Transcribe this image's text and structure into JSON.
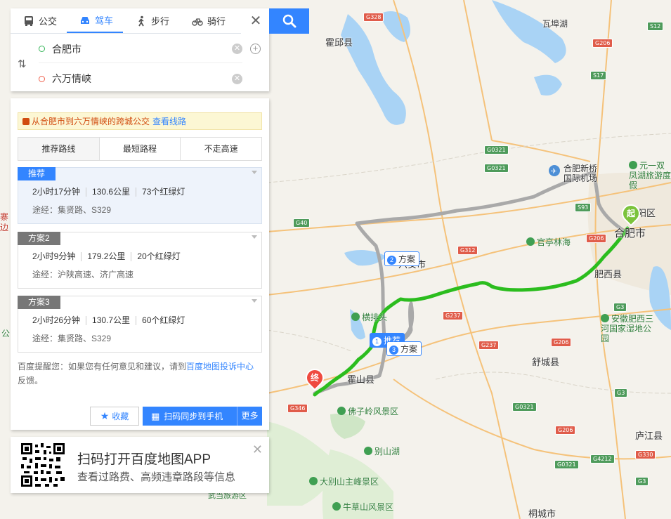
{
  "modes": {
    "bus": "公交",
    "drive": "驾车",
    "walk": "步行",
    "bike": "骑行"
  },
  "route": {
    "from": "合肥市",
    "to": "六万情峡"
  },
  "bus_tip": {
    "text": "从合肥市到六万情峡的跨城公交",
    "link": "查看线路"
  },
  "strategies": [
    "推荐路线",
    "最短路程",
    "不走高速"
  ],
  "plans": [
    {
      "tag": "推荐",
      "time": "2小时17分钟",
      "distance": "130.6公里",
      "lights": "73个红绿灯",
      "via": "途经：集贤路、S329"
    },
    {
      "tag": "方案2",
      "time": "2小时9分钟",
      "distance": "179.2公里",
      "lights": "20个红绿灯",
      "via": "途经：沪陕高速、济广高速"
    },
    {
      "tag": "方案3",
      "time": "2小时26分钟",
      "distance": "130.7公里",
      "lights": "60个红绿灯",
      "via": "途经：集贤路、S329"
    }
  ],
  "notice": {
    "before": "百度提醒您：如果您有任何意见和建议，请到",
    "link": "百度地图投诉中心",
    "after": "反馈。"
  },
  "actions": {
    "favorite": "收藏",
    "sync": "扫码同步到手机",
    "more": "更多"
  },
  "qr_card": {
    "title": "扫码打开百度地图APP",
    "subtitle": "查看过路费、高频违章路段等信息"
  },
  "map": {
    "labels": {
      "huoqiu": "霍邱县",
      "wawuhu": "瓦埠湖",
      "hefei": "合肥市",
      "yangqu": "阳区",
      "feixi": "肥西县",
      "shucheng": "舒城县",
      "huoshan": "霍山县",
      "luan": "六安市",
      "lujiang": "庐江县",
      "tongcheng": "桐城市",
      "hefei_airport": "合肥新桥国际机场",
      "yiyi_lake": "元一双凤湖旅游度假",
      "guanting": "官亭林海",
      "hengpai": "横排头",
      "three_rivers": "安徽肥西三河国家湿地公园",
      "fozi": "佛子岭风景区",
      "bieshan": "别山湖",
      "dabie": "大别山主峰景区",
      "niucao": "牛草山风景区",
      "wudang": "武当旅游区",
      "left_edge_1": "寨",
      "left_edge_2": "边",
      "left_edge_3": "公"
    },
    "road_badges": [
      "G328",
      "S12",
      "G206",
      "S17",
      "G0321",
      "G0321",
      "S93",
      "G206",
      "G40",
      "G312",
      "G3",
      "G237",
      "G237",
      "G206",
      "G3",
      "G346",
      "G0321",
      "G206",
      "G4212",
      "G330",
      "G0321",
      "G3"
    ],
    "plan_tags": {
      "rec_num": "1",
      "rec_label": "推荐",
      "p2_num": "2",
      "p2_label": "方案",
      "p3_num": "3",
      "p3_label": "方案"
    },
    "pins": {
      "start": "起",
      "end": "终"
    },
    "colors": {
      "recommended_route": "#2bbd1e",
      "alt_route": "#a9a9a9",
      "water": "#a9d3f5",
      "accent": "#3385ff"
    }
  }
}
